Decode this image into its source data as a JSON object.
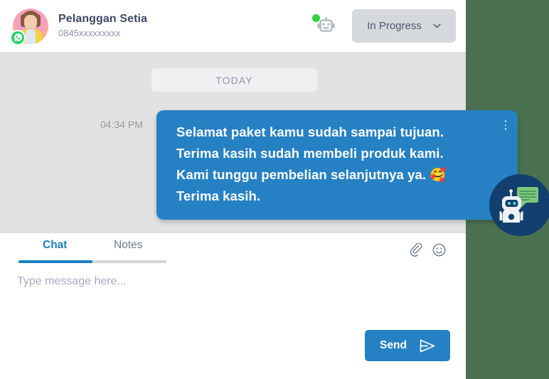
{
  "header": {
    "contact_name": "Pelanggan Setia",
    "contact_phone": "0845xxxxxxxxx",
    "avatar_name": "customer-avatar",
    "channel_badge": "whatsapp-icon",
    "bot_indicator": "robot-icon",
    "bot_online": true,
    "status": {
      "selected": "In Progress",
      "options": [
        "In Progress"
      ]
    }
  },
  "conversation": {
    "date_divider": "TODAY",
    "messages": [
      {
        "time": "04:34 PM",
        "text": "Selamat paket kamu sudah sampai tujuan.\nTerima kasih sudah membeli produk kami.\nKami tunggu pembelian selanjutnya ya. 🥰\nTerima kasih.",
        "direction": "outgoing",
        "menu_icon": "kebab-menu-icon"
      }
    ]
  },
  "composer": {
    "tabs": [
      {
        "label": "Chat",
        "active": true
      },
      {
        "label": "Notes",
        "active": false
      }
    ],
    "attach_icon": "paperclip-icon",
    "emoji_icon": "smiley-icon",
    "input_value": "",
    "input_placeholder": "Type message here...",
    "send_label": "Send",
    "send_icon": "send-arrow-icon"
  },
  "floating_action": {
    "name": "chatbot-fab",
    "icon": "robot-chat-icon"
  },
  "colors": {
    "accent_blue": "#2681c4",
    "page_background": "#4a7050",
    "chat_background": "#e2e2e2",
    "status_chip": "#d5d9dd",
    "fab_navy": "#123f6e",
    "whatsapp_green": "#25d366",
    "online_green": "#2ed13b"
  }
}
